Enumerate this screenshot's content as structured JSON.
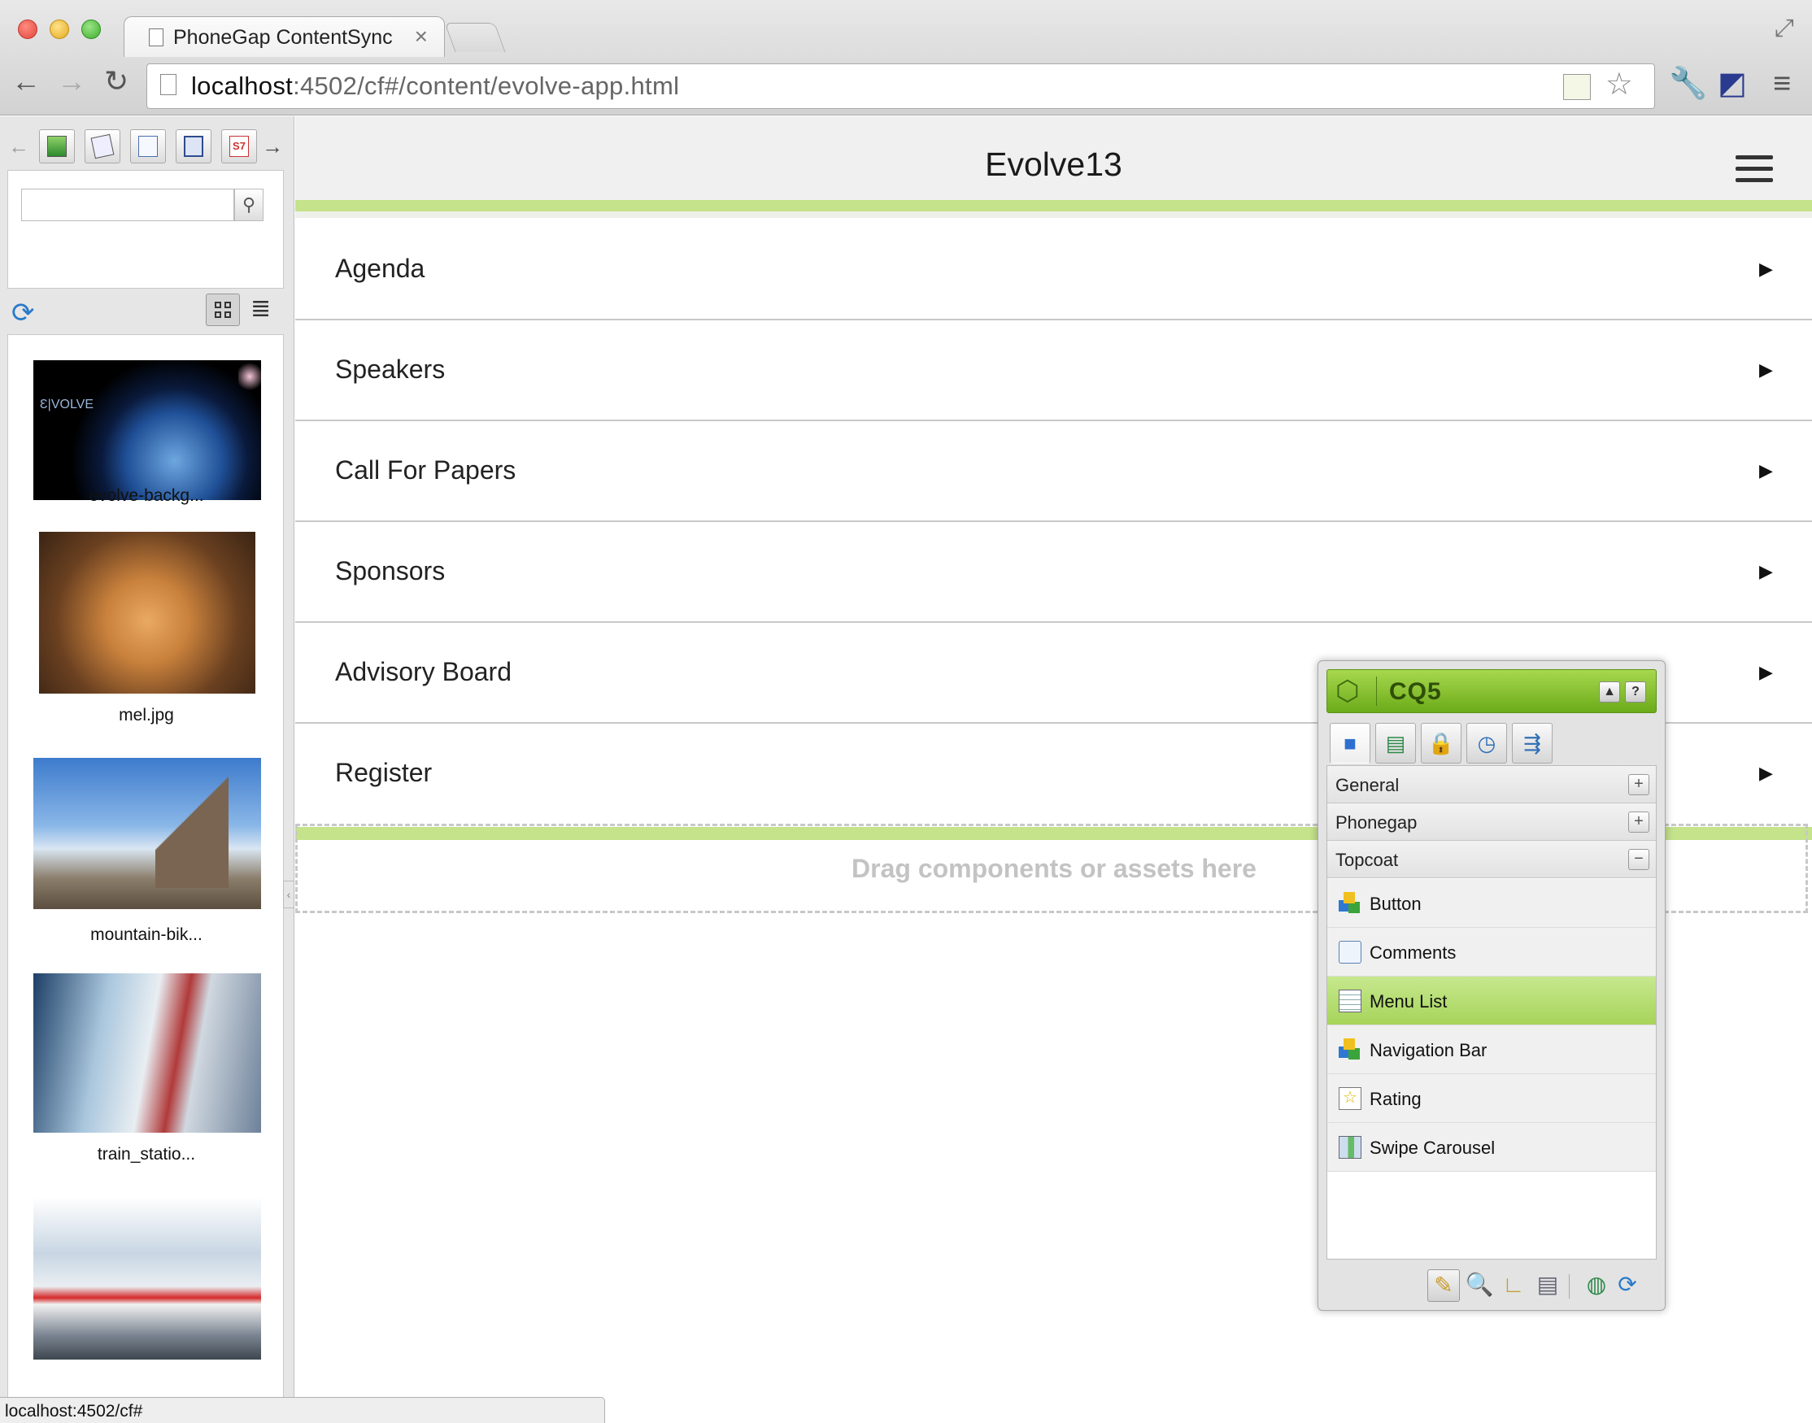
{
  "browser": {
    "tab_title": "PhoneGap ContentSync",
    "tab_close": "×",
    "url_host": "localhost",
    "url_rest": ":4502/cf#/content/evolve-app.html"
  },
  "sidekick_panel": {
    "search_placeholder": "",
    "assets": [
      {
        "label": "evolve-backg..."
      },
      {
        "label": "mel.jpg"
      },
      {
        "label": "mountain-bik..."
      },
      {
        "label": "train_statio..."
      },
      {
        "label": ""
      }
    ],
    "thumb_text": "Ɛ|VOLVE"
  },
  "app": {
    "title": "Evolve13",
    "menu": [
      {
        "label": "Agenda"
      },
      {
        "label": "Speakers"
      },
      {
        "label": "Call For Papers"
      },
      {
        "label": "Sponsors"
      },
      {
        "label": "Advisory Board"
      },
      {
        "label": "Register"
      }
    ],
    "arrow": "▶",
    "dropzone_text": "Drag components or assets here"
  },
  "cq5": {
    "title": "CQ5",
    "groups": [
      {
        "label": "General",
        "toggle": "+"
      },
      {
        "label": "Phonegap",
        "toggle": "+"
      },
      {
        "label": "Topcoat",
        "toggle": "−"
      }
    ],
    "components": [
      {
        "label": "Button"
      },
      {
        "label": "Comments"
      },
      {
        "label": "Menu List"
      },
      {
        "label": "Navigation Bar"
      },
      {
        "label": "Rating"
      },
      {
        "label": "Swipe Carousel"
      }
    ],
    "selected_component": "Menu List"
  },
  "status": {
    "text": "localhost:4502/cf#"
  },
  "colors": {
    "accent_green": "#c4e38b",
    "cq5_green": "#6bab1a"
  }
}
